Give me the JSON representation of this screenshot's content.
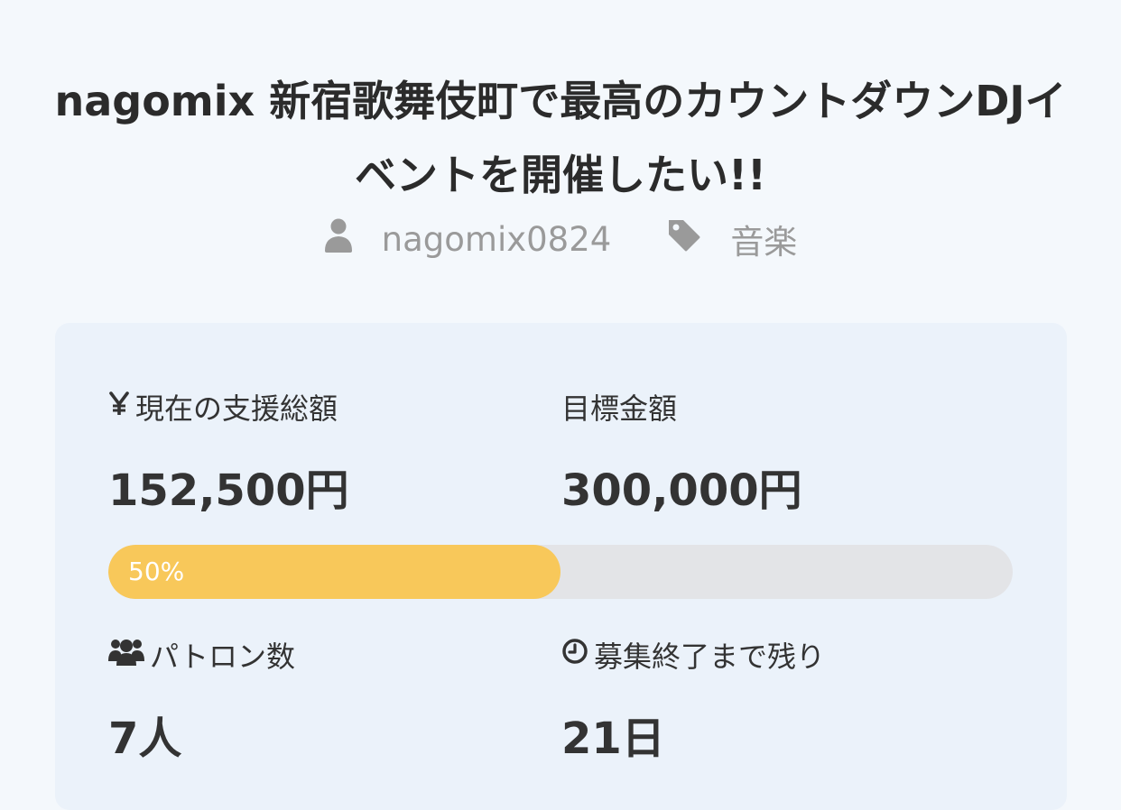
{
  "project": {
    "title": "nagomix 新宿歌舞伎町で最高のカウントダウンDJイベントを開催したい!!",
    "owner": "nagomix0824",
    "category": "音楽"
  },
  "stats": {
    "current": {
      "label": "現在の支援総額",
      "value": "152,500円",
      "icon": "yen-icon"
    },
    "goal": {
      "label": "目標金額",
      "value": "300,000円"
    },
    "patrons": {
      "label": "パトロン数",
      "value": "7人",
      "icon": "users-icon"
    },
    "remaining": {
      "label": "募集終了まで残り",
      "value": "21日",
      "icon": "clock-icon"
    }
  },
  "progress": {
    "percent": 50,
    "label": "50%",
    "fill_color": "#f8c85a",
    "track_color": "#e3e4e7"
  },
  "colors": {
    "page_bg": "#f4f8fc",
    "card_bg": "#ebf2fa",
    "meta_text": "#9a9a9a"
  }
}
